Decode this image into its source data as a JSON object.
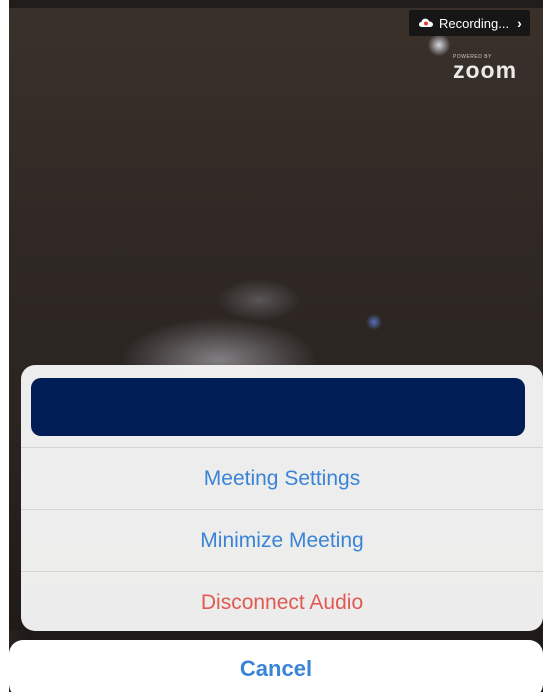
{
  "recording": {
    "label": "Recording...",
    "chevron": "›",
    "icon": "cloud-recording-icon"
  },
  "branding": {
    "powered_by": "POWERED BY",
    "logo": "zoom"
  },
  "action_sheet": {
    "items": [
      {
        "label": "Meeting Settings",
        "style": "default"
      },
      {
        "label": "Minimize Meeting",
        "style": "default"
      },
      {
        "label": "Disconnect Audio",
        "style": "destructive"
      }
    ],
    "cancel_label": "Cancel"
  },
  "colors": {
    "action_blue": "#3a84d6",
    "destructive_red": "#e05a52",
    "redaction_navy": "#001d56"
  }
}
